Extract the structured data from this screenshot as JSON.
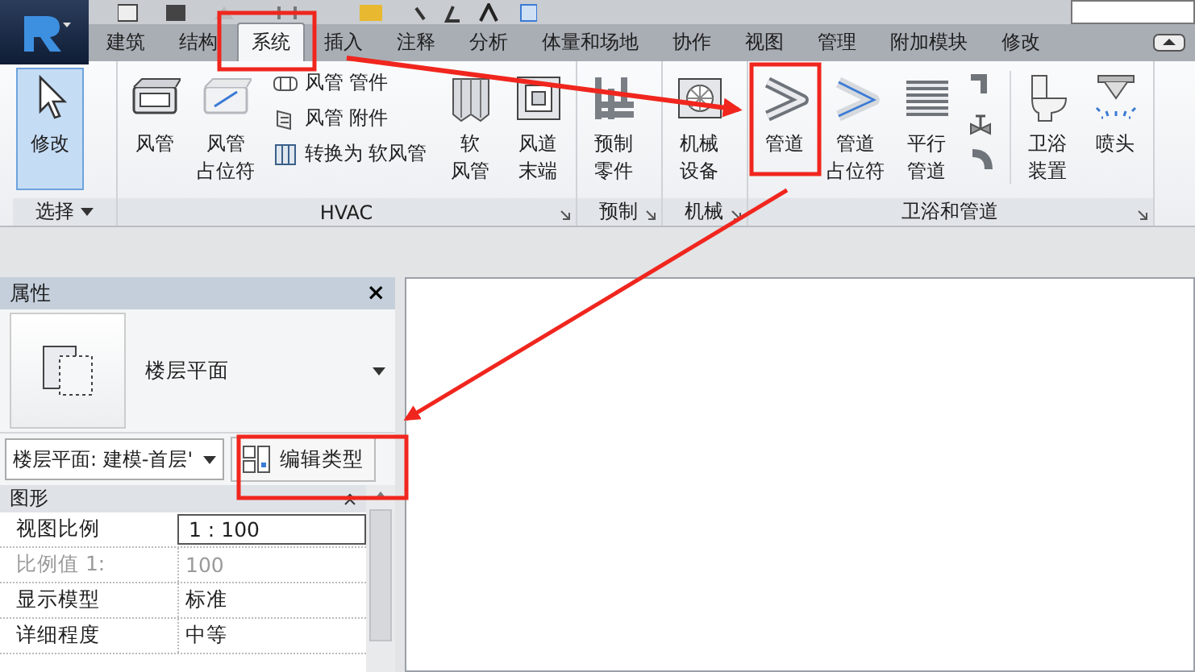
{
  "tabs": [
    {
      "label": "建筑",
      "selected": false
    },
    {
      "label": "结构",
      "selected": false
    },
    {
      "label": "系统",
      "selected": true
    },
    {
      "label": "插入",
      "selected": false
    },
    {
      "label": "注释",
      "selected": false
    },
    {
      "label": "分析",
      "selected": false
    },
    {
      "label": "体量和场地",
      "selected": false
    },
    {
      "label": "协作",
      "selected": false
    },
    {
      "label": "视图",
      "selected": false
    },
    {
      "label": "管理",
      "selected": false
    },
    {
      "label": "附加模块",
      "selected": false
    },
    {
      "label": "修改",
      "selected": false
    }
  ],
  "ribbon": {
    "panels": [
      {
        "label": "选择",
        "dropdown": true,
        "launcher": false,
        "items": [
          {
            "kind": "large",
            "lines": [
              "修改"
            ],
            "active": true
          }
        ]
      },
      {
        "label": "HVAC",
        "dropdown": false,
        "launcher": true,
        "items": [
          {
            "kind": "large",
            "lines": [
              "风管"
            ],
            "active": false
          },
          {
            "kind": "large",
            "lines": [
              "风管",
              "占位符"
            ],
            "active": false
          },
          {
            "kind": "stack",
            "entries": [
              "风管 管件",
              "风管 附件",
              "转换为 软风管"
            ]
          },
          {
            "kind": "large",
            "lines": [
              "软",
              "风管"
            ],
            "active": false
          },
          {
            "kind": "large",
            "lines": [
              "风道",
              "末端"
            ],
            "active": false
          }
        ]
      },
      {
        "label": "预制",
        "dropdown": false,
        "launcher": true,
        "items": [
          {
            "kind": "large",
            "lines": [
              "预制",
              "零件"
            ],
            "active": false
          }
        ]
      },
      {
        "label": "机械",
        "dropdown": false,
        "launcher": true,
        "items": [
          {
            "kind": "large",
            "lines": [
              "机械",
              "设备"
            ],
            "active": false
          }
        ]
      },
      {
        "label": "卫浴和管道",
        "dropdown": false,
        "launcher": true,
        "items": [
          {
            "kind": "large",
            "lines": [
              "管道"
            ],
            "active": false
          },
          {
            "kind": "large",
            "lines": [
              "管道",
              "占位符"
            ],
            "active": false
          },
          {
            "kind": "large",
            "lines": [
              "平行",
              "管道"
            ],
            "active": false
          },
          {
            "kind": "icon-column"
          },
          {
            "kind": "separator"
          },
          {
            "kind": "large",
            "lines": [
              "卫浴",
              "装置"
            ],
            "active": false
          },
          {
            "kind": "large",
            "lines": [
              "喷头"
            ],
            "active": false
          }
        ]
      }
    ]
  },
  "properties": {
    "title": "属性",
    "close_glyph": "×",
    "type_name": "楼层平面",
    "instance_selector": "楼层平面: 建模-首层'",
    "edit_type_button": "编辑类型",
    "section": "图形",
    "rows": [
      {
        "label": "视图比例",
        "value": "1 : 100",
        "kind": "field",
        "disabled": false
      },
      {
        "label": "比例值 1:",
        "value": "100",
        "kind": "text",
        "disabled": true
      },
      {
        "label": "显示模型",
        "value": "标准",
        "kind": "text",
        "disabled": false
      },
      {
        "label": "详细程度",
        "value": "中等",
        "kind": "text",
        "disabled": false
      }
    ]
  }
}
